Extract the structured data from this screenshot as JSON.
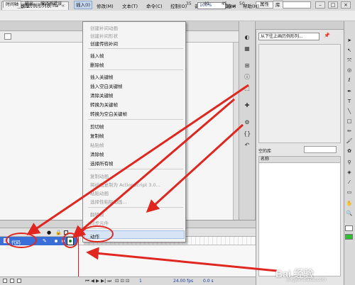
{
  "app": {
    "logo": "Fl",
    "workspace_label": "基本功能 ▾",
    "win_min": "–",
    "win_max": "□",
    "win_close": "×"
  },
  "menubar": {
    "items": [
      "文件(F)",
      "编辑(E)",
      "视图(V)",
      "插入(I)",
      "修改(M)",
      "文本(T)",
      "命令(C)",
      "控制(O)",
      "调试(D)",
      "窗口(W)",
      "帮助(H)"
    ],
    "active_index": 3
  },
  "document": {
    "tab_label": "从下往上画历例形列表.fla",
    "tab_close": "×",
    "scene_label": "场景 1",
    "zoom": "100%"
  },
  "context_menu": {
    "items": [
      {
        "label": "创建补间动画",
        "disabled": true
      },
      {
        "label": "创建补间形状",
        "disabled": true
      },
      {
        "label": "创建传统补间",
        "disabled": false
      },
      {
        "label": "插入帧",
        "disabled": false
      },
      {
        "label": "删除帧",
        "disabled": false
      },
      {
        "label": "插入关键帧",
        "disabled": false
      },
      {
        "label": "插入空白关键帧",
        "disabled": false
      },
      {
        "label": "清除关键帧",
        "disabled": false
      },
      {
        "label": "转换为关键帧",
        "disabled": false
      },
      {
        "label": "转换为空白关键帧",
        "disabled": false
      },
      {
        "label": "剪切帧",
        "disabled": false
      },
      {
        "label": "复制帧",
        "disabled": false
      },
      {
        "label": "粘贴帧",
        "disabled": true
      },
      {
        "label": "清除帧",
        "disabled": false
      },
      {
        "label": "选择所有帧",
        "disabled": false
      },
      {
        "label": "复制动画",
        "disabled": true
      },
      {
        "label": "将动画复制为 ActionScript 3.0...",
        "disabled": true
      },
      {
        "label": "粘贴动画",
        "disabled": true
      },
      {
        "label": "选择性粘贴动画...",
        "disabled": true
      },
      {
        "label": "翻转帧",
        "disabled": true
      },
      {
        "label": "同步元件",
        "disabled": true
      },
      {
        "label": "动作",
        "disabled": false,
        "highlighted": true
      }
    ]
  },
  "timeline": {
    "tabs": [
      "时间轴",
      "输出",
      "编译器错误"
    ],
    "frame_numbers": [
      "35",
      "40",
      "45",
      "50"
    ],
    "layer_name": "代码",
    "fps": "24.00 fps",
    "elapsed": "0.0 s",
    "current_frame": "1"
  },
  "right_panel": {
    "tabs": [
      "属性",
      "库"
    ],
    "library_select": "从下往上画历例形列...",
    "item_count": "空的库",
    "column_header": "名称"
  },
  "watermark": {
    "text": "Bai 经验",
    "url": "jingyan.baidu.com"
  },
  "colors": {
    "annotation": "#e0261f",
    "layer_selected": "#3a6fd8",
    "fill_swatch": "#2fbf2f"
  }
}
